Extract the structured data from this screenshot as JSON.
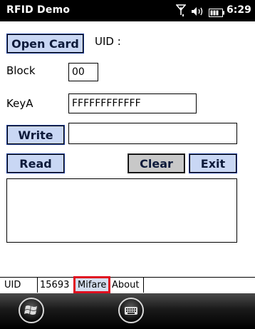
{
  "title_bar": {
    "app_title": "RFID Demo",
    "time": "6:29",
    "icons": [
      "signal-icon",
      "volume-icon",
      "battery-icon"
    ]
  },
  "main": {
    "open_card_label": "Open Card",
    "uid_label": "UID :",
    "block_label": "Block",
    "block_value": "00",
    "keya_label": "KeyA",
    "keya_value": "FFFFFFFFFFFF",
    "write_label": "Write",
    "write_value": "",
    "read_label": "Read",
    "clear_label": "Clear",
    "exit_label": "Exit",
    "output_value": ""
  },
  "tabs": [
    {
      "label": "UID"
    },
    {
      "label": "15693"
    },
    {
      "label": "Mifare",
      "active": true
    },
    {
      "label": "About"
    }
  ],
  "taskbar": {
    "icons": [
      "windows-start-icon",
      "keyboard-icon"
    ]
  },
  "colors": {
    "title_bar_bg": "#000000",
    "button_blue": "#c9d7f4",
    "button_gray": "#c8c8c8",
    "highlight_red": "#e01020"
  }
}
